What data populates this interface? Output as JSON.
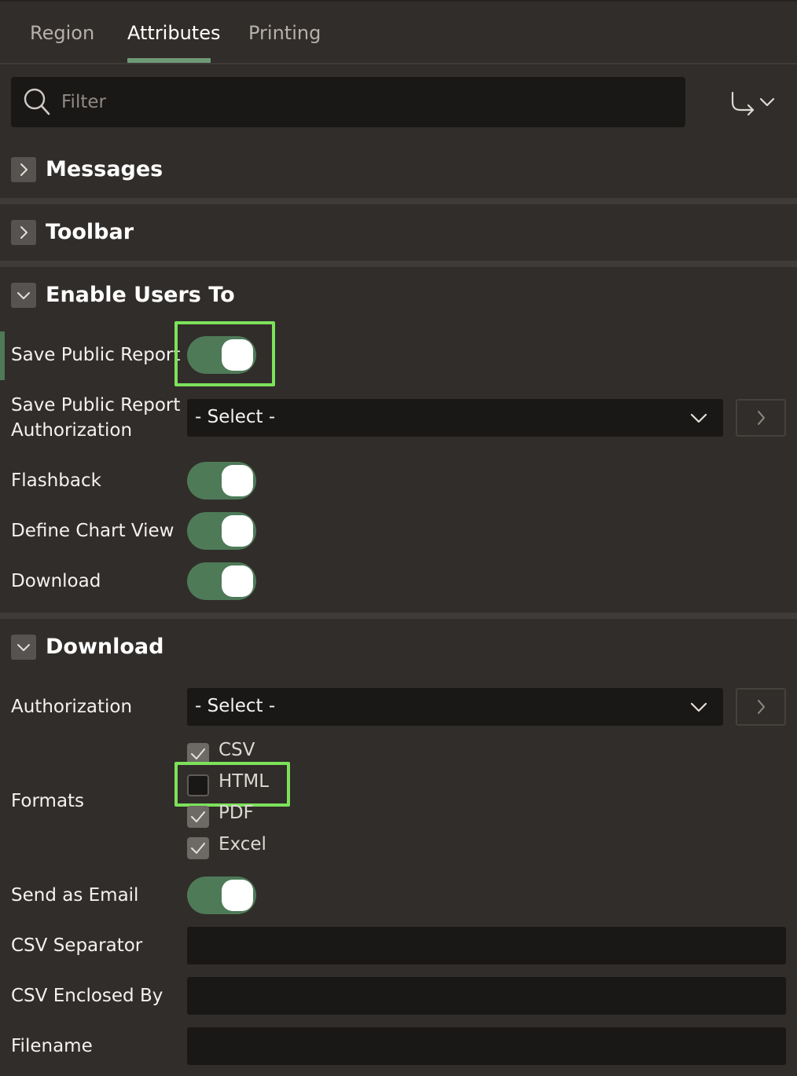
{
  "tabs": [
    {
      "label": "Region",
      "active": false
    },
    {
      "label": "Attributes",
      "active": true
    },
    {
      "label": "Printing",
      "active": false
    }
  ],
  "filter": {
    "placeholder": "Filter",
    "value": ""
  },
  "toolbar": {
    "goto_icon": "goto-group-arrow-icon",
    "dropdown_icon": "chevron-down-icon"
  },
  "sections": {
    "messages": {
      "title": "Messages",
      "expanded": false
    },
    "toolbar": {
      "title": "Toolbar",
      "expanded": false
    },
    "enable_users_to": {
      "title": "Enable Users To",
      "expanded": true
    },
    "download": {
      "title": "Download",
      "expanded": true
    }
  },
  "enable_users_to": {
    "save_public_report": {
      "label": "Save Public Report",
      "on": true
    },
    "save_public_report_auth": {
      "label": "Save Public Report Authorization",
      "value": "- Select -"
    },
    "flashback": {
      "label": "Flashback",
      "on": true
    },
    "define_chart_view": {
      "label": "Define Chart View",
      "on": true
    },
    "download": {
      "label": "Download",
      "on": true
    }
  },
  "download": {
    "authorization": {
      "label": "Authorization",
      "value": "- Select -"
    },
    "formats": {
      "label": "Formats",
      "options": [
        {
          "label": "CSV",
          "checked": true
        },
        {
          "label": "HTML",
          "checked": false
        },
        {
          "label": "PDF",
          "checked": true
        },
        {
          "label": "Excel",
          "checked": true
        }
      ]
    },
    "send_as_email": {
      "label": "Send as Email",
      "on": true
    },
    "csv_separator": {
      "label": "CSV Separator",
      "value": ""
    },
    "csv_enclosed_by": {
      "label": "CSV Enclosed By",
      "value": ""
    },
    "filename": {
      "label": "Filename",
      "value": ""
    }
  },
  "colors": {
    "accent_green": "#4e7a58",
    "highlight": "#7ce25a",
    "background": "#312d2a",
    "field": "#1a1816"
  }
}
